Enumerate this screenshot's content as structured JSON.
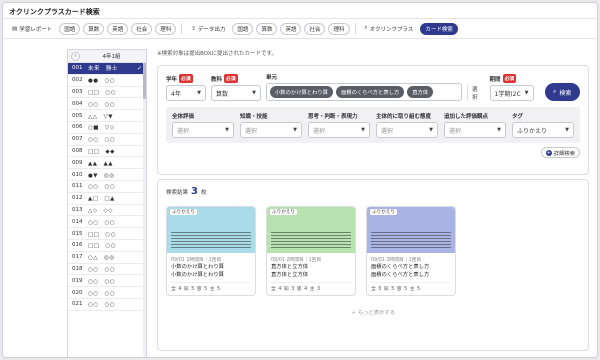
{
  "app": {
    "title": "オクリンクプラスカード検索"
  },
  "toolbar": {
    "items": [
      {
        "label": "学習レポート",
        "icon": "report-icon",
        "style": "plain"
      },
      {
        "label": "国語",
        "style": "pill"
      },
      {
        "label": "算数",
        "style": "pill"
      },
      {
        "label": "英語",
        "style": "pill"
      },
      {
        "label": "社会",
        "style": "pill"
      },
      {
        "label": "理科",
        "style": "pill"
      },
      {
        "label": "データ出力",
        "icon": "export-icon",
        "style": "plain"
      },
      {
        "label": "国語",
        "style": "pill"
      },
      {
        "label": "算数",
        "style": "pill"
      },
      {
        "label": "英語",
        "style": "pill"
      },
      {
        "label": "社会",
        "style": "pill"
      },
      {
        "label": "理科",
        "style": "pill"
      },
      {
        "label": "オクリンクプラス",
        "icon": "search-icon",
        "style": "plain"
      },
      {
        "label": "カード検索",
        "style": "primary"
      }
    ]
  },
  "sidebar": {
    "class_label": "4年1組",
    "back_icon": "chevron-left-icon",
    "students": [
      {
        "no": "001",
        "name": "未来　勝士",
        "selected": true
      },
      {
        "no": "002",
        "name": "●●　○○"
      },
      {
        "no": "003",
        "name": "□□　○○"
      },
      {
        "no": "004",
        "name": "○○　○○"
      },
      {
        "no": "005",
        "name": "△△　▽▼"
      },
      {
        "no": "006",
        "name": "○■　▽◇"
      },
      {
        "no": "007",
        "name": "○○　○○"
      },
      {
        "no": "008",
        "name": "□□　◆◆"
      },
      {
        "no": "009",
        "name": "▲▲　▲▲"
      },
      {
        "no": "010",
        "name": "●▼　◎◎"
      },
      {
        "no": "011",
        "name": "○○　○○"
      },
      {
        "no": "012",
        "name": "▲□　□▲"
      },
      {
        "no": "013",
        "name": "△◇　◇◇"
      },
      {
        "no": "014",
        "name": "○○　○○"
      },
      {
        "no": "015",
        "name": "□□　○○"
      },
      {
        "no": "016",
        "name": "□□　○○"
      },
      {
        "no": "017",
        "name": "○△　◎◎"
      },
      {
        "no": "018",
        "name": "○○　○○"
      },
      {
        "no": "019",
        "name": "○○　○○"
      },
      {
        "no": "020",
        "name": "○○　○○"
      },
      {
        "no": "021",
        "name": "○○　○○"
      }
    ]
  },
  "main": {
    "note": "※検索対象は提出BOXに提出されたカードです。",
    "filters": {
      "required_label": "必須",
      "grade": {
        "label": "学年",
        "value": "4年"
      },
      "subject": {
        "label": "教科",
        "value": "算数"
      },
      "unit": {
        "label": "単元",
        "chips": [
          "小数のかけ算とわり算",
          "面積のくらべ方と表し方",
          "直方体"
        ],
        "select_label": "選択"
      },
      "term": {
        "label": "期間",
        "value": "1学期(2C"
      },
      "search_label": "検索"
    },
    "subfilters": [
      {
        "label": "全体評価",
        "placeholder": "選択"
      },
      {
        "label": "知識・技能",
        "placeholder": "選択"
      },
      {
        "label": "思考・判断・表現力",
        "placeholder": "選択"
      },
      {
        "label": "主体的に取り組む態度",
        "placeholder": "選択"
      },
      {
        "label": "追加した評価観点",
        "placeholder": "選択"
      },
      {
        "label": "タグ",
        "value": "ふりかえり"
      }
    ],
    "detail_search_label": "詳細検索",
    "results": {
      "label": "検索結果",
      "count": "3",
      "unit": "枚",
      "more_label": "もっと表示する",
      "cards": [
        {
          "tag": "ふりかえり",
          "date": "09/01 1時間目｜1回目",
          "title_line1": "小数のかけ算とわり算",
          "title_line2": "小数のかけ算とわり算",
          "footer": "全 4 知 5 思 5 主 5",
          "color": "#a9dbe8"
        },
        {
          "tag": "ふりかえり",
          "date": "09/01 2時間目｜1回目",
          "title_line1": "直方体と立方体",
          "title_line2": "直方体と立方体",
          "footer": "全 4 知 3 思 4 主 3",
          "color": "#b8e2b0"
        },
        {
          "tag": "ふりかえり",
          "date": "09/01 3時間目｜1回目",
          "title_line1": "面積のくらべ方と表し方",
          "title_line2": "面積のくらべ方と表し方",
          "footer": "全 5 知 5 思 5 主 5",
          "color": "#aab4e4"
        }
      ]
    }
  }
}
